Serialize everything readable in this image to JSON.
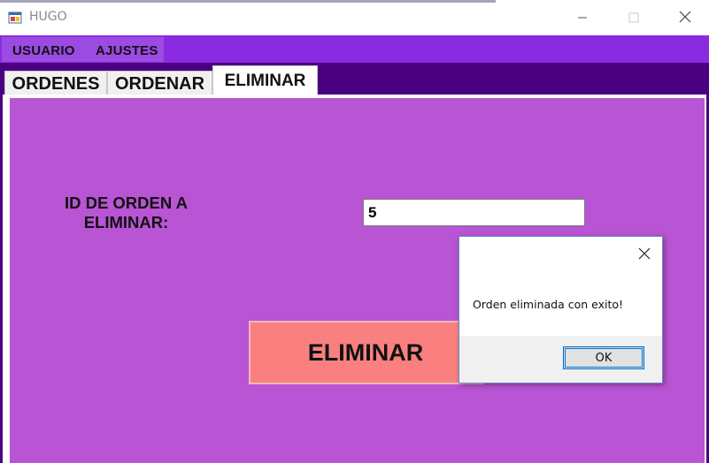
{
  "window": {
    "title": "HUGO",
    "icon": "app-window-icon",
    "controls": [
      "minimize-icon",
      "maximize-icon",
      "close-icon"
    ]
  },
  "menu": {
    "items": [
      {
        "label": "USUARIO"
      },
      {
        "label": "AJUSTES"
      }
    ]
  },
  "tabs": [
    {
      "label": "ORDENES",
      "active": false
    },
    {
      "label": "ORDENAR",
      "active": false
    },
    {
      "label": "ELIMINAR",
      "active": true
    }
  ],
  "form": {
    "id_label": "ID DE ORDEN A ELIMINAR:",
    "id_value": "5",
    "delete_label": "ELIMINAR"
  },
  "dialog": {
    "message": "Orden eliminada con exito!",
    "ok_label": "OK"
  },
  "colors": {
    "menubar": "#8a2be2",
    "tab_band": "#4b0082",
    "panel": "#b954d4",
    "delete_button": "#fa8080"
  }
}
